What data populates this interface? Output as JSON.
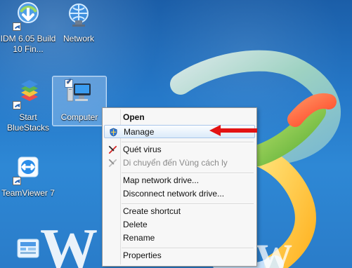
{
  "desktop": {
    "icons": [
      {
        "label": "IDM 6.05 Build 10 Fin..."
      },
      {
        "label": "Network"
      },
      {
        "label": "Computer"
      },
      {
        "label": "Start BlueStacks"
      },
      {
        "label": "TeamViewer 7"
      }
    ]
  },
  "context_menu": {
    "items": [
      {
        "label": "Open"
      },
      {
        "label": "Manage"
      },
      {
        "label": "Quét virus"
      },
      {
        "label": "Di chuyển đến Vùng cách ly"
      },
      {
        "label": "Map network drive..."
      },
      {
        "label": "Disconnect network drive..."
      },
      {
        "label": "Create shortcut"
      },
      {
        "label": "Delete"
      },
      {
        "label": "Rename"
      },
      {
        "label": "Properties"
      }
    ]
  },
  "colors": {
    "desktop_blue": "#2a7cc9",
    "menu_highlight": "#dbeaf9",
    "pointer_red": "#e31313"
  },
  "icons": {
    "menu_manage": "shield-icon",
    "menu_scan": "virus-scan-icon",
    "menu_quarantine": "quarantine-icon",
    "pointer": "red-arrow-icon"
  }
}
